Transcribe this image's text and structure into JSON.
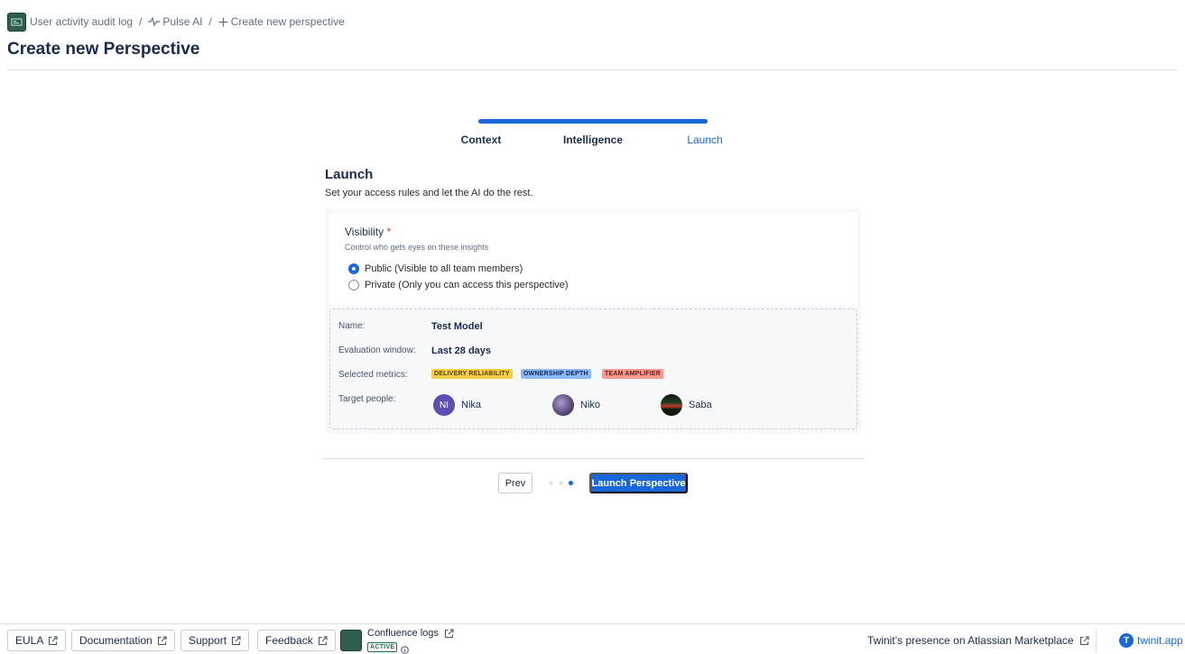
{
  "breadcrumb": {
    "items": [
      {
        "label": "User activity audit log",
        "icon": "app-logo-icon"
      },
      {
        "label": "Pulse AI",
        "icon": "pulse-icon"
      },
      {
        "label": "Create new perspective",
        "icon": "plus-icon"
      }
    ]
  },
  "page": {
    "title": "Create new Perspective"
  },
  "stepper": {
    "steps": [
      {
        "label": "Context",
        "active": false
      },
      {
        "label": "Intelligence",
        "active": false
      },
      {
        "label": "Launch",
        "active": true
      }
    ],
    "progress": 1.0
  },
  "section": {
    "title": "Launch",
    "subtitle": "Set your access rules and let the AI do the rest."
  },
  "visibility": {
    "label": "Visibility",
    "required_mark": "*",
    "help": "Control who gets eyes on these insights",
    "options": [
      {
        "label": "Public (Visible to all team members)",
        "checked": true
      },
      {
        "label": "Private (Only you can access this perspective)",
        "checked": false
      }
    ]
  },
  "summary": {
    "name_label": "Name:",
    "name_value": "Test Model",
    "window_label": "Evaluation window:",
    "window_value": "Last 28 days",
    "metrics_label": "Selected metrics:",
    "metrics": [
      {
        "label": "DELIVERY RELIABILITY",
        "bg": "#f5cd47",
        "fg": "#533f04"
      },
      {
        "label": "OWNERSHIP DEPTH",
        "bg": "#8fb8f6",
        "fg": "#092957"
      },
      {
        "label": "TEAM AMPLIFIER",
        "bg": "#fd9891",
        "fg": "#5d1f1a"
      }
    ],
    "people_label": "Target people:",
    "people": [
      {
        "name": "Nika",
        "initials": "NI",
        "color": "#5e4db2"
      },
      {
        "name": "Niko",
        "initials": "",
        "color": "#6b5a86"
      },
      {
        "name": "Saba",
        "initials": "",
        "color": "#1f2a1f"
      }
    ]
  },
  "nav": {
    "prev_label": "Prev",
    "launch_label": "Launch Perspective",
    "current_step": 3,
    "total_steps": 3
  },
  "footer": {
    "eula": "EULA",
    "docs": "Documentation",
    "support": "Support",
    "feedback": "Feedback",
    "conf_title": "Confluence logs",
    "conf_badge": "ACTIVE",
    "marketplace": "Twinit’s presence on Atlassian Marketplace",
    "brand": "twinit.app"
  },
  "colors": {
    "accent": "#1868db",
    "text": "#172b4d",
    "success": "#216e4e"
  }
}
